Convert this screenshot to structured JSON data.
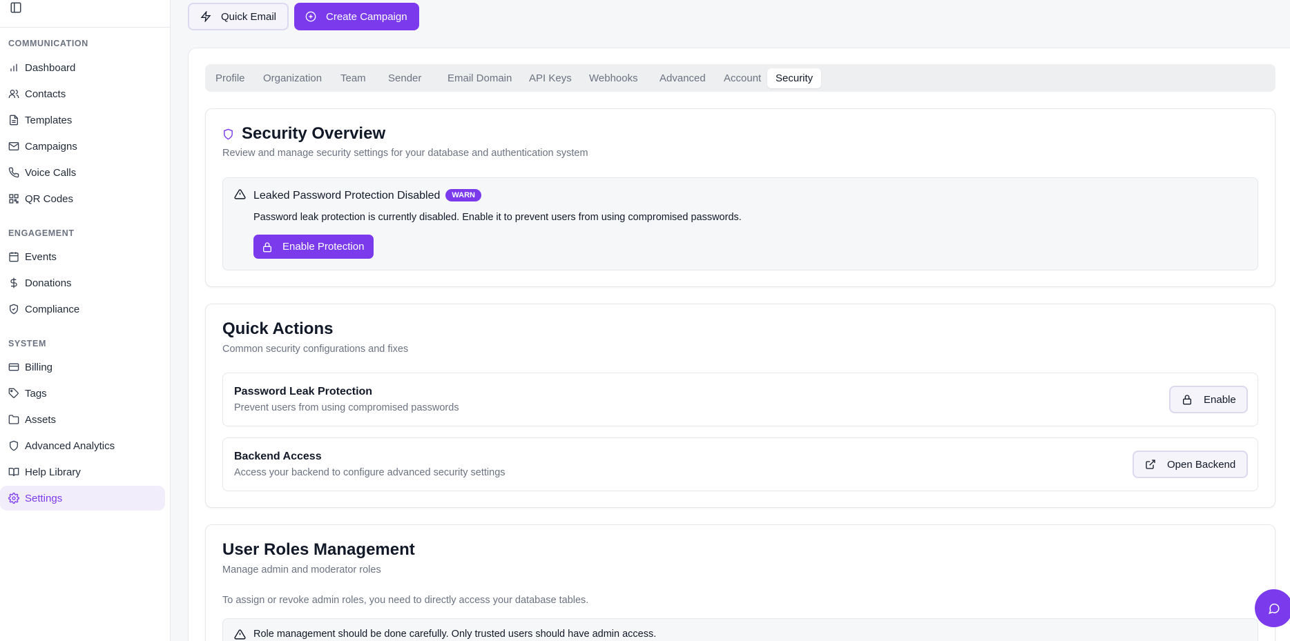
{
  "sidebar": {
    "sections": [
      {
        "title": "COMMUNICATION",
        "items": [
          {
            "label": "Dashboard",
            "icon": "bar-chart-icon"
          },
          {
            "label": "Contacts",
            "icon": "users-icon"
          },
          {
            "label": "Templates",
            "icon": "file-text-icon"
          },
          {
            "label": "Campaigns",
            "icon": "mail-icon"
          },
          {
            "label": "Voice Calls",
            "icon": "phone-icon"
          },
          {
            "label": "QR Codes",
            "icon": "qr-code-icon"
          }
        ]
      },
      {
        "title": "ENGAGEMENT",
        "items": [
          {
            "label": "Events",
            "icon": "calendar-icon"
          },
          {
            "label": "Donations",
            "icon": "dollar-icon"
          },
          {
            "label": "Compliance",
            "icon": "shield-check-icon"
          }
        ]
      },
      {
        "title": "SYSTEM",
        "items": [
          {
            "label": "Billing",
            "icon": "credit-card-icon"
          },
          {
            "label": "Tags",
            "icon": "tag-icon"
          },
          {
            "label": "Assets",
            "icon": "folder-icon"
          },
          {
            "label": "Advanced Analytics",
            "icon": "shield-icon"
          },
          {
            "label": "Help Library",
            "icon": "book-icon"
          },
          {
            "label": "Settings",
            "icon": "gear-icon"
          }
        ]
      }
    ],
    "active": "Settings"
  },
  "toolbar": {
    "quick_email": "Quick Email",
    "create_campaign": "Create Campaign"
  },
  "tabs": [
    "Profile",
    "Organization",
    "Team",
    "Sender",
    "Email Domain",
    "API Keys",
    "Webhooks",
    "Advanced",
    "Account",
    "Security"
  ],
  "active_tab": "Security",
  "security_overview": {
    "title": "Security Overview",
    "subtitle": "Review and manage security settings for your database and authentication system",
    "alert": {
      "title": "Leaked Password Protection Disabled",
      "badge": "WARN",
      "message": "Password leak protection is currently disabled. Enable it to prevent users from using compromised passwords.",
      "button": "Enable Protection"
    }
  },
  "quick_actions": {
    "title": "Quick Actions",
    "subtitle": "Common security configurations and fixes",
    "items": [
      {
        "title": "Password Leak Protection",
        "description": "Prevent users from using compromised passwords",
        "button": "Enable"
      },
      {
        "title": "Backend Access",
        "description": "Access your backend to configure advanced security settings",
        "button": "Open Backend"
      }
    ]
  },
  "user_roles": {
    "title": "User Roles Management",
    "subtitle": "Manage admin and moderator roles",
    "note": "To assign or revoke admin roles, you need to directly access your database tables.",
    "warning": "Role management should be done carefully. Only trusted users should have admin access."
  },
  "colors": {
    "accent": "#7c3aed",
    "active_bg": "#f1edfb"
  }
}
